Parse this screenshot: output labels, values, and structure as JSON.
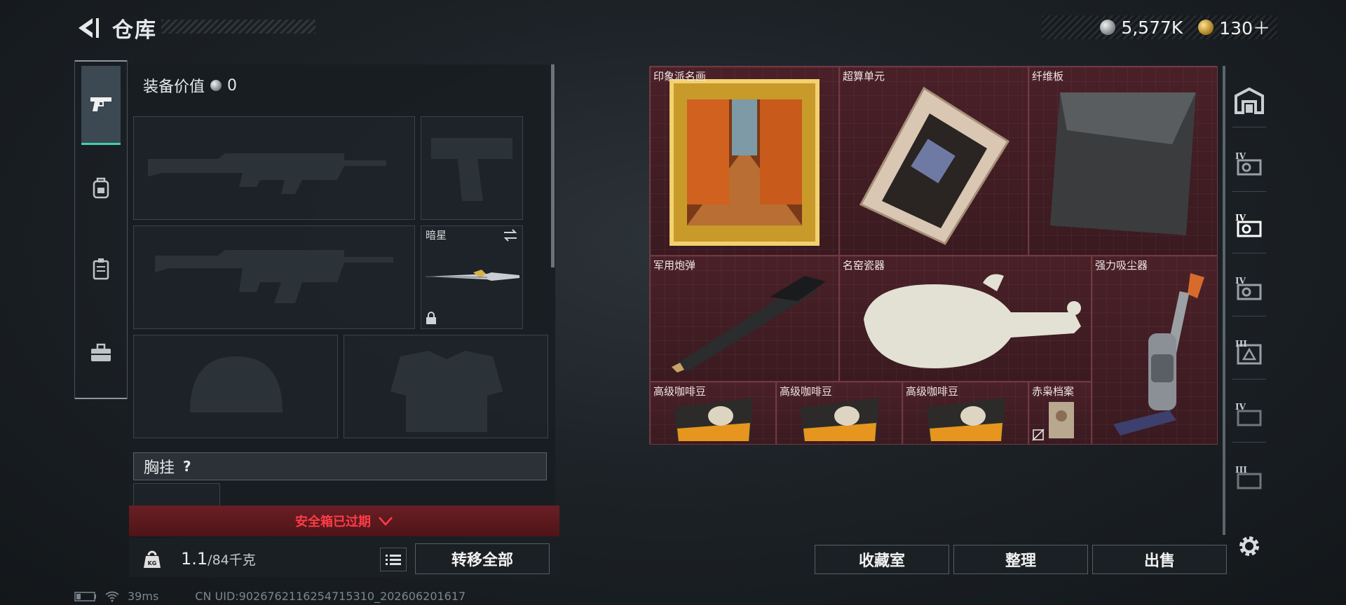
{
  "header": {
    "title": "仓库",
    "currency_silver": "5,577K",
    "currency_gold": "130＋"
  },
  "equipment": {
    "value_label": "装备价值",
    "value": "0",
    "melee_slot_label": "暗星",
    "chest_rig_label": "胸挂",
    "chest_rig_help": "?",
    "safe_box_warning": "安全箱已过期",
    "weight_current": "1.1",
    "weight_capacity": "/84千克",
    "transfer_all": "转移全部"
  },
  "stash": {
    "items": [
      {
        "name": "印象派名画"
      },
      {
        "name": "超算单元"
      },
      {
        "name": "纤维板"
      },
      {
        "name": "军用炮弹"
      },
      {
        "name": "名窑瓷器"
      },
      {
        "name": "强力吸尘器"
      },
      {
        "name": "高级咖啡豆"
      },
      {
        "name": "高级咖啡豆"
      },
      {
        "name": "高级咖啡豆"
      },
      {
        "name": "赤枭档案"
      }
    ],
    "buttons": {
      "collection": "收藏室",
      "sort": "整理",
      "sell": "出售"
    }
  },
  "right_tabs": [
    "IV",
    "IV",
    "IV",
    "III",
    "IV",
    "III"
  ],
  "status": {
    "ping": "39ms",
    "uid": "CN UID:9026762116254715310_202606201617"
  },
  "colors": {
    "accent_teal": "#3fd0b1",
    "warning_red": "#ff3c48",
    "stash_bg": "#3a1c22"
  }
}
